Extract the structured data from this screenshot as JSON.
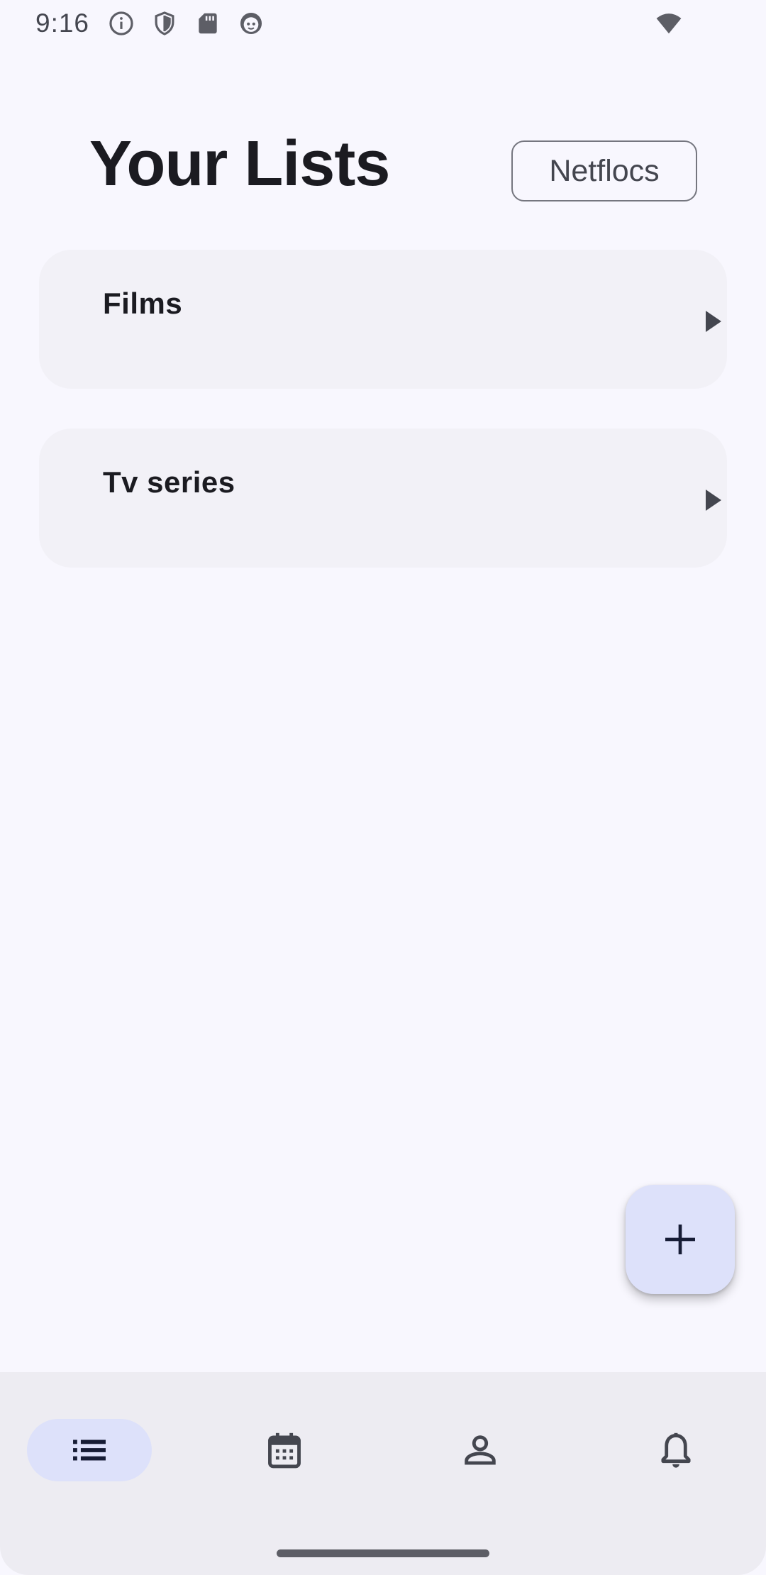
{
  "status_bar": {
    "time": "9:16",
    "icons": [
      "info-icon",
      "shield-icon",
      "sd-card-icon",
      "android-face-icon",
      "wifi-icon"
    ]
  },
  "header": {
    "title": "Your Lists",
    "app_chip_label": "Netflocs"
  },
  "lists": [
    {
      "title": "Films",
      "icon": "chevron-right-icon"
    },
    {
      "title": "Tv series",
      "icon": "chevron-right-icon"
    }
  ],
  "fab": {
    "icon": "plus-icon"
  },
  "bottom_nav": {
    "items": [
      {
        "icon": "list-icon",
        "active": true
      },
      {
        "icon": "calendar-icon",
        "active": false
      },
      {
        "icon": "person-icon",
        "active": false
      },
      {
        "icon": "bell-icon",
        "active": false
      }
    ]
  },
  "colors": {
    "background": "#f8f7fe",
    "card": "#f2f1f7",
    "accent_container": "#dde1fa",
    "nav_background": "#edecf2",
    "text_primary": "#1b1b21",
    "icon": "#44464f"
  }
}
